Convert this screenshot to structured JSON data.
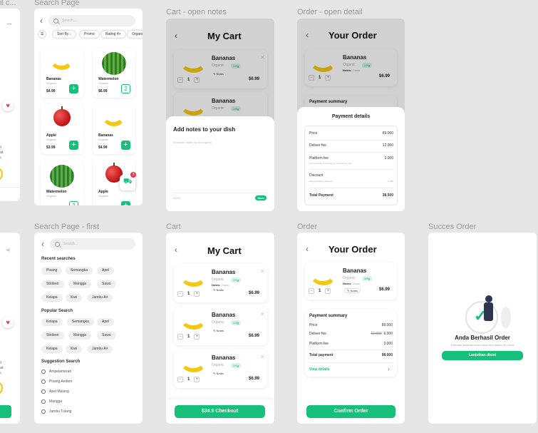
{
  "frame_labels": {
    "search_page": "Search Page",
    "cart_open_notes": "Cart - open notes",
    "order_open_detail": "Order - open detail",
    "search_page_first": "Search Page - first",
    "cart": "Cart",
    "order": "Order",
    "succes_order": "Succes Order",
    "left_partial": "il c..."
  },
  "search_page": {
    "search_placeholder": "Search...",
    "filters": [
      "Sort By",
      "Promo",
      "Rating 4+",
      "Organic"
    ],
    "products": [
      {
        "name": "Bananas",
        "sub": "Organic",
        "price": "$4.99",
        "fruit": "banana"
      },
      {
        "name": "Watermelon",
        "sub": "Organic",
        "price": "$6.99",
        "fruit": "melon"
      },
      {
        "name": "Apple",
        "sub": "Organic",
        "price": "$3.99",
        "fruit": "apple"
      },
      {
        "name": "Bananas",
        "sub": "Organic",
        "price": "$4.99",
        "fruit": "banana"
      },
      {
        "name": "Watermelon",
        "sub": "Organic",
        "price": "",
        "fruit": "melon"
      },
      {
        "name": "Apple",
        "sub": "Organic",
        "price": "",
        "fruit": "apple"
      }
    ],
    "cart_badge": "3",
    "add_icon": "+",
    "added_count": "2"
  },
  "search_first": {
    "search_placeholder": "Search...",
    "recent_title": "Recent searches",
    "recent": [
      "Pisang",
      "Semangka",
      "Apel",
      "Stroberi",
      "Mangga",
      "Sawo",
      "Kelapa",
      "Kiwi",
      "Jambu Air"
    ],
    "popular_title": "Popular Search",
    "popular": [
      "Kelapa",
      "Semangka",
      "Apel",
      "Stroberi",
      "Mangga",
      "Sawo",
      "Kelapa",
      "Kiwi",
      "Jambu Air"
    ],
    "suggestion_title": "Suggestion Search",
    "suggestions": [
      "Ampelamerah",
      "Pisang Ambon",
      "Apel Malang",
      "Mangga",
      "Jambu Tulang"
    ]
  },
  "cart": {
    "title": "My Cart",
    "item_name": "Bananas",
    "item_sub": "Organic",
    "item_weight": "1 Kg",
    "notes_label": "Notes:",
    "notes_value": "Gaulu",
    "notes_button": "Notes",
    "qty": "1",
    "price": "$6.99",
    "checkout": "$34.9 Checkout"
  },
  "cart_notes": {
    "sheet_title": "Add notes to your dish",
    "placeholder": "Example: make my food spicy!",
    "counter": "0/200",
    "save": "Save"
  },
  "order": {
    "title": "Your Order",
    "summary_title": "Payment summary",
    "rows": [
      {
        "label": "Price",
        "value": "89.000"
      },
      {
        "label": "Deliver fee",
        "old": "12.000",
        "value": "6.000"
      },
      {
        "label": "Platform fee",
        "value": "3.000"
      }
    ],
    "total_label": "Total payment",
    "total_value": "98.000",
    "view_details": "View details",
    "confirm": "Confirm Order"
  },
  "order_detail": {
    "sheet_title": "Payment details",
    "price_label": "Price",
    "price_value": "89.000",
    "deliver_label": "Deliver fee",
    "deliver_value": "12.000",
    "platform_label": "Platform fee",
    "platform_value": "3.000",
    "platform_note": "Fo us to keep improving our services for you",
    "discount_label": "Discount",
    "discount_note": "Saving delivery discount",
    "discount_value": "-6.000",
    "total_label": "Total Payment",
    "total_value": "38.500"
  },
  "success": {
    "title": "Anda Berhasil Order",
    "subtitle": "Estimasi pesanan kamu akan tiba dalam 30 menit",
    "button": "Lanjutkan disini"
  },
  "colors": {
    "accent": "#16c07a",
    "banana": "#f3c813",
    "heart": "#e8374c"
  }
}
